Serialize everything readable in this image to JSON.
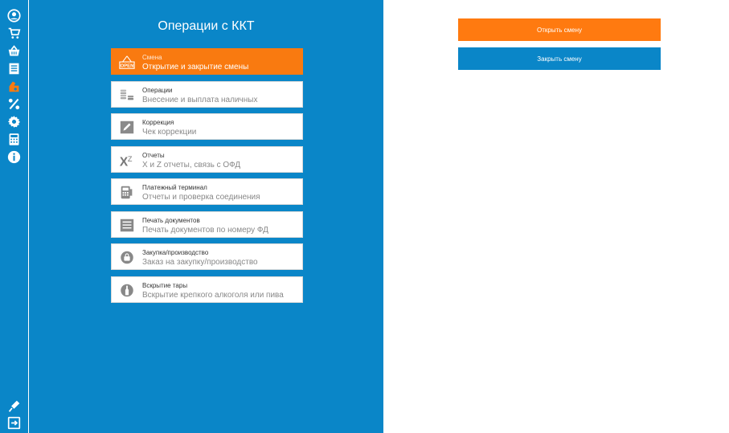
{
  "colors": {
    "primary": "#0a86c8",
    "accent": "#f97a10",
    "text_dark": "#333333",
    "text_gray": "#888888"
  },
  "rail": {
    "icons": [
      "user-icon",
      "cart-icon",
      "basket-icon",
      "document-list-icon",
      "cash-register-icon",
      "percent-icon",
      "gear-icon",
      "calculator-icon",
      "info-icon"
    ],
    "bottom_icons": [
      "plug-icon",
      "logout-icon"
    ],
    "active_icon": "cash-register-icon"
  },
  "panel": {
    "title": "Операции с ККТ",
    "items": [
      {
        "title": "Смена",
        "subtitle": "Открытие и закрытие смены",
        "icon": "open-sign-icon",
        "active": true
      },
      {
        "title": "Операции",
        "subtitle": "Внесение и выплата наличных",
        "icon": "coins-icon",
        "active": false
      },
      {
        "title": "Коррекция",
        "subtitle": "Чек коррекции",
        "icon": "pencil-icon",
        "active": false
      },
      {
        "title": "Отчеты",
        "subtitle": "X и Z отчеты, связь с ОФД",
        "icon": "xz-icon",
        "active": false
      },
      {
        "title": "Платежный терминал",
        "subtitle": "Отчеты и проверка соединения",
        "icon": "terminal-icon",
        "active": false
      },
      {
        "title": "Печать документов",
        "subtitle": "Печать документов по номеру ФД",
        "icon": "print-document-icon",
        "active": false
      },
      {
        "title": "Закупка/производство",
        "subtitle": "Заказ на закупку/производство",
        "icon": "bag-icon",
        "active": false
      },
      {
        "title": "Вскрытие тары",
        "subtitle": "Вскрытие крепкого алкоголя или пива",
        "icon": "bottle-icon",
        "active": false
      }
    ]
  },
  "actions": {
    "open_shift": "Открыть смену",
    "close_shift": "Закрыть смену"
  }
}
